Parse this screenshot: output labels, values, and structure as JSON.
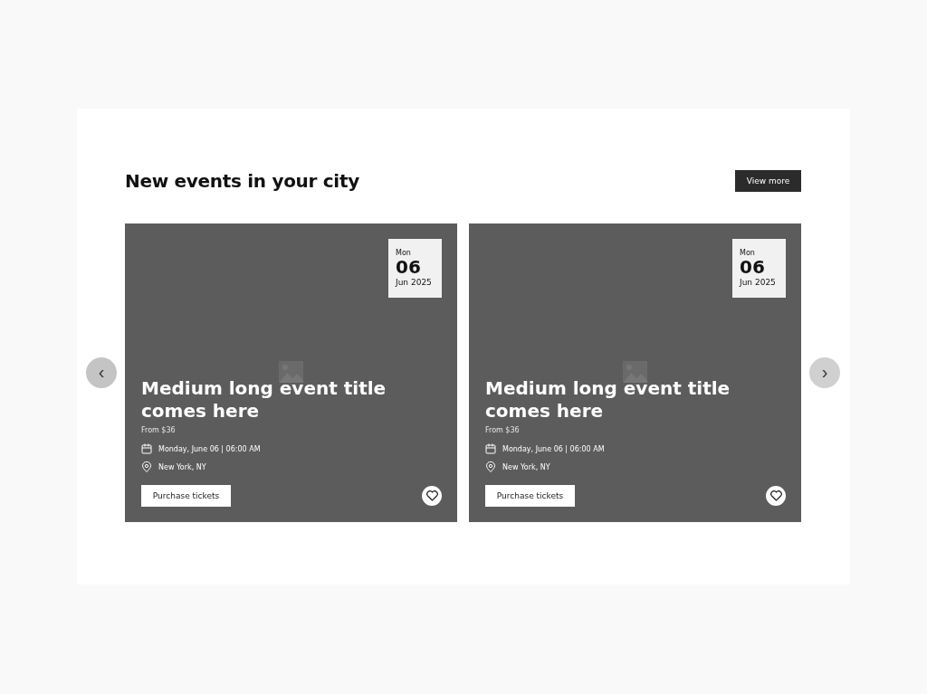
{
  "section": {
    "title": "New events in your city",
    "view_more": "View more"
  },
  "carousel": {
    "prev": "‹",
    "next": "›"
  },
  "events": [
    {
      "day_name": "Mon",
      "day": "06",
      "month_year": "Jun 2025",
      "title": "Medium long event title comes here",
      "price": "From $36",
      "datetime": "Monday, June 06 | 06:00 AM",
      "location": "New York, NY",
      "action": "Purchase tickets",
      "favorite": false
    },
    {
      "day_name": "Mon",
      "day": "06",
      "month_year": "Jun 2025",
      "title": "Medium long event title comes here",
      "price": "From $36",
      "datetime": "Monday, June 06 | 06:00 AM",
      "location": "New York, NY",
      "action": "Purchase tickets",
      "favorite": false
    }
  ]
}
